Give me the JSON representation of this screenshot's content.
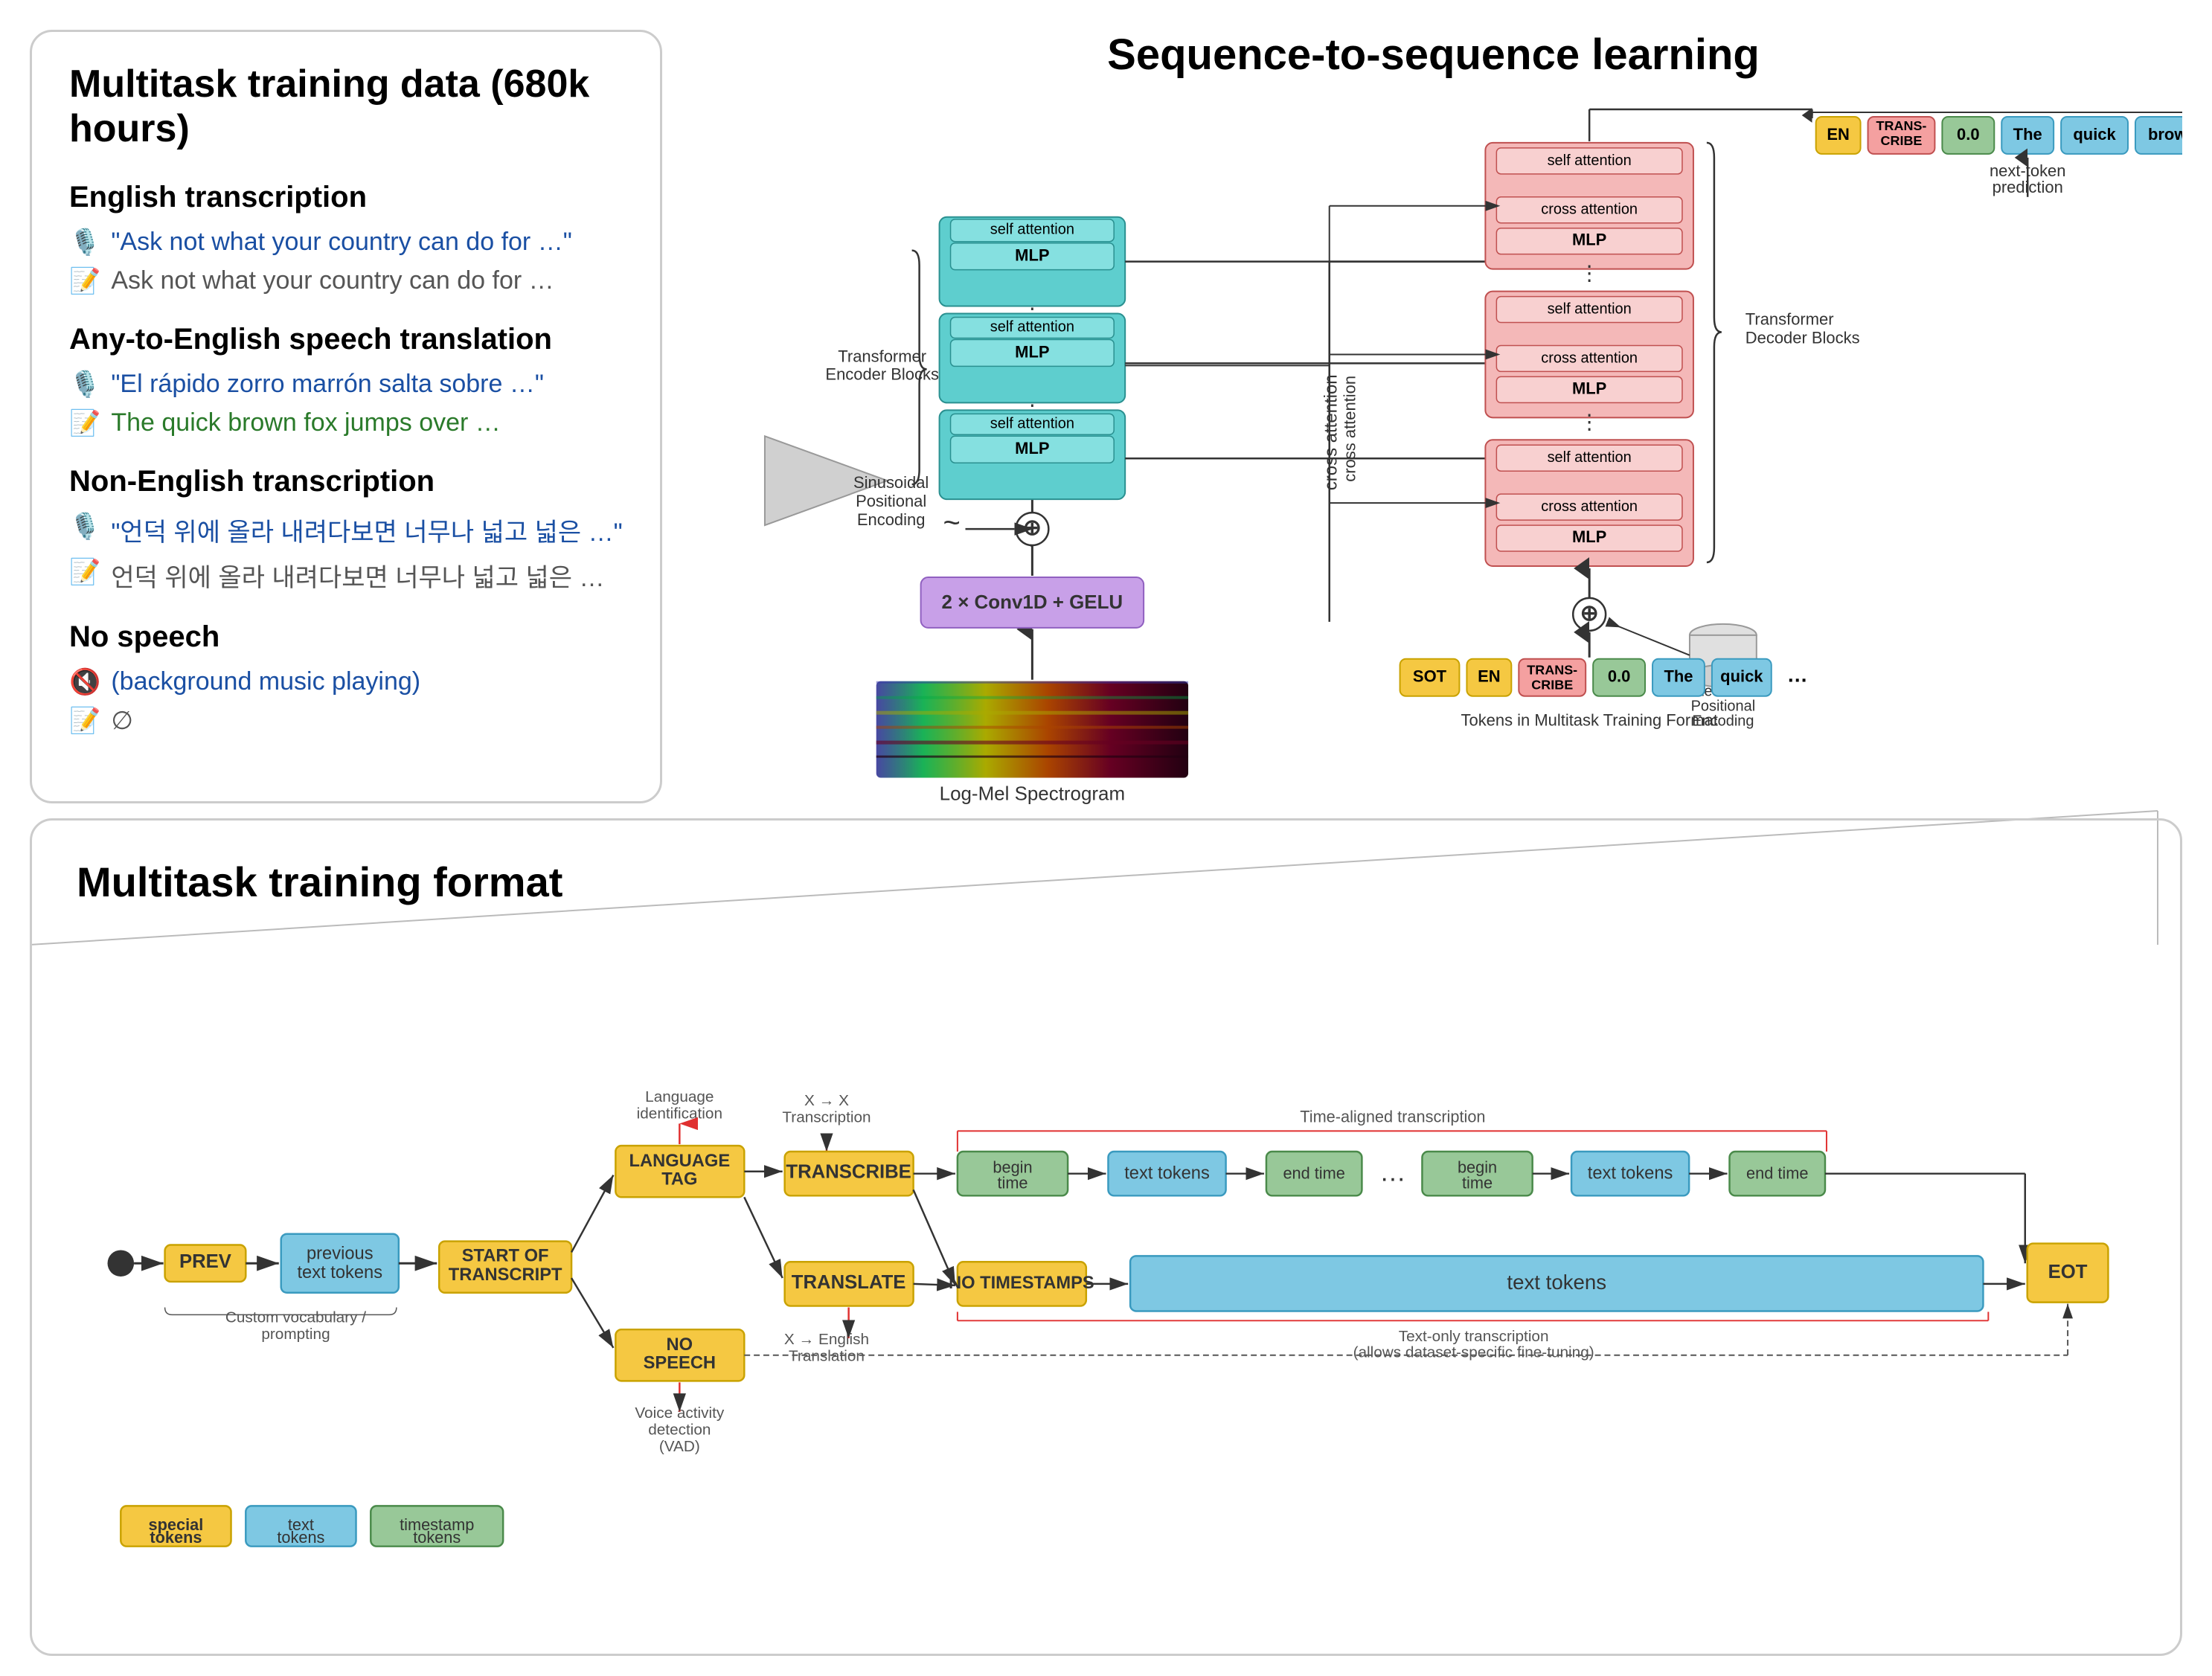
{
  "top": {
    "left": {
      "title": "Multitask training data (680k hours)",
      "sections": [
        {
          "heading": "English transcription",
          "rows": [
            {
              "icon": "🎙️",
              "text": "\"Ask not what your country can do for …\"",
              "type": "audio"
            },
            {
              "icon": "📝",
              "text": "Ask not what your country can do for …",
              "type": "text"
            }
          ]
        },
        {
          "heading": "Any-to-English speech translation",
          "rows": [
            {
              "icon": "🎙️",
              "text": "\"El rápido zorro marrón salta sobre …\"",
              "type": "audio"
            },
            {
              "icon": "📝",
              "text": "The quick brown fox jumps over …",
              "type": "text-green"
            }
          ]
        },
        {
          "heading": "Non-English transcription",
          "rows": [
            {
              "icon": "🎙️",
              "text": "\"언덕 위에 올라 내려다보면 너무나 넓고 넓은 …\"",
              "type": "audio"
            },
            {
              "icon": "📝",
              "text": "언덕 위에 올라 내려다보면 너무나 넓고 넓은 …",
              "type": "text"
            }
          ]
        },
        {
          "heading": "No speech",
          "rows": [
            {
              "icon": "🔇",
              "text": "(background music playing)",
              "type": "audio"
            },
            {
              "icon": "📝",
              "text": "∅",
              "type": "text"
            }
          ]
        }
      ]
    },
    "right": {
      "title": "Sequence-to-sequence learning",
      "encoder_label": "Transformer\nEncoder Blocks",
      "decoder_label": "Transformer\nDecoder Blocks",
      "conv_label": "2 × Conv1D + GELU",
      "spectrogram_label": "Log-Mel Spectrogram",
      "positional_label": "Sinusoidal\nPositional\nEncoding",
      "learned_pos_label": "Learned\nPositional\nEncoding",
      "tokens_label": "Tokens in Multitask Training Format",
      "next_token_label": "next-token\nprediction",
      "cross_attention_label": "cross attention",
      "mlp": "MLP",
      "self_attention": "self attention",
      "cross_attention_block": "cross attention",
      "output_tokens": [
        "EN",
        "TRANS-\nCRIBE",
        "0.0",
        "The",
        "quick",
        "brown",
        "…"
      ],
      "input_tokens": [
        "SOT",
        "EN",
        "TRANS-\nCRIBE",
        "0.0",
        "The",
        "quick",
        "…"
      ]
    }
  },
  "bottom": {
    "title": "Multitask training format",
    "nodes": {
      "prev": "PREV",
      "previous_text": "previous\ntext tokens",
      "start_transcript": "START OF\nTRANSCRIPT",
      "language_tag": "LANGUAGE\nTAG",
      "no_speech": "NO\nSPEECH",
      "transcribe": "TRANSCRIBE",
      "translate": "TRANSLATE",
      "begin_time": "begin\ntime",
      "text_tokens": "text tokens",
      "end_time": "end time",
      "begin_time2": "begin\ntime",
      "text_tokens2": "text tokens",
      "end_time2": "end time",
      "no_timestamps": "NO\nTIMESTAMPS",
      "text_tokens_wide": "text tokens",
      "eot": "EOT"
    },
    "labels": {
      "language_id": "Language\nidentification",
      "x_to_x": "X → X\nTranscription",
      "time_aligned": "Time-aligned transcription",
      "x_to_english": "X → English\nTranslation",
      "voice_activity": "Voice activity\ndetection\n(VAD)",
      "custom_vocab": "Custom vocabulary /\nprompting",
      "text_only": "Text-only transcription\n(allows dataset-specific fine-tuning)"
    },
    "legend": {
      "special_tokens": "special\ntokens",
      "text_tokens": "text\ntokens",
      "timestamp_tokens": "timestamp\ntokens"
    }
  }
}
